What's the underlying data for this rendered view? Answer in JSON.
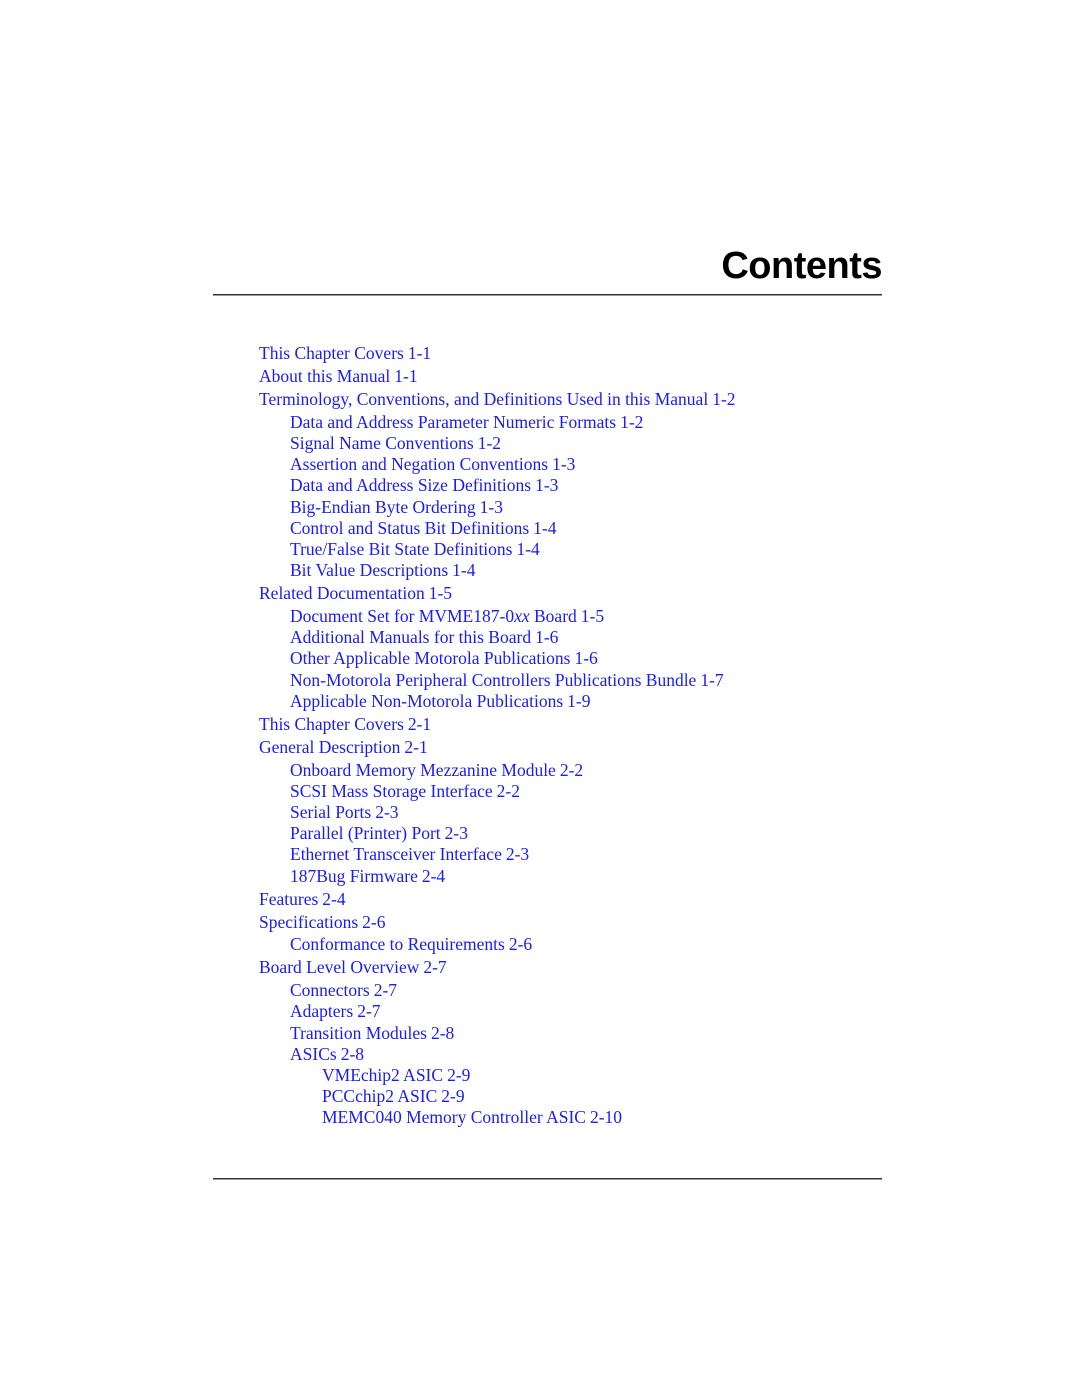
{
  "page_title": "Contents",
  "toc": [
    {
      "level": 1,
      "title": "This Chapter Covers",
      "page": "1-1"
    },
    {
      "level": 1,
      "title": "About this Manual",
      "page": "1-1"
    },
    {
      "level": 1,
      "title": "Terminology, Conventions, and Definitions Used in this Manual",
      "page": "1-2"
    },
    {
      "level": 2,
      "title": "Data and Address Parameter Numeric Formats",
      "page": "1-2"
    },
    {
      "level": 2,
      "title": "Signal Name Conventions",
      "page": "1-2"
    },
    {
      "level": 2,
      "title": "Assertion and Negation Conventions",
      "page": "1-3"
    },
    {
      "level": 2,
      "title": "Data and Address Size Definitions",
      "page": "1-3"
    },
    {
      "level": 2,
      "title": "Big-Endian Byte Ordering",
      "page": "1-3"
    },
    {
      "level": 2,
      "title": "Control and Status Bit Definitions",
      "page": "1-4"
    },
    {
      "level": 2,
      "title": "True/False Bit State Definitions",
      "page": "1-4"
    },
    {
      "level": 2,
      "title": "Bit Value Descriptions",
      "page": "1-4"
    },
    {
      "level": 1,
      "title": "Related Documentation",
      "page": "1-5"
    },
    {
      "level": 2,
      "title": "Document Set for MVME187-0",
      "title_italic": "xx",
      "title_suffix": " Board",
      "page": "1-5"
    },
    {
      "level": 2,
      "title": "Additional Manuals for this Board",
      "page": "1-6"
    },
    {
      "level": 2,
      "title": "Other Applicable Motorola Publications",
      "page": "1-6"
    },
    {
      "level": 2,
      "title": "Non-Motorola Peripheral Controllers Publications Bundle",
      "page": "1-7"
    },
    {
      "level": 2,
      "title": "Applicable Non-Motorola Publications",
      "page": "1-9"
    },
    {
      "level": 1,
      "title": "This Chapter Covers",
      "page": "2-1"
    },
    {
      "level": 1,
      "title": "General Description",
      "page": "2-1"
    },
    {
      "level": 2,
      "title": "Onboard Memory Mezzanine Module",
      "page": "2-2"
    },
    {
      "level": 2,
      "title": "SCSI Mass Storage Interface",
      "page": "2-2"
    },
    {
      "level": 2,
      "title": "Serial Ports",
      "page": "2-3"
    },
    {
      "level": 2,
      "title": "Parallel (Printer) Port",
      "page": "2-3"
    },
    {
      "level": 2,
      "title": "Ethernet Transceiver Interface",
      "page": "2-3"
    },
    {
      "level": 2,
      "title": "187Bug Firmware",
      "page": "2-4"
    },
    {
      "level": 1,
      "title": "Features",
      "page": "2-4"
    },
    {
      "level": 1,
      "title": "Specifications",
      "page": "2-6"
    },
    {
      "level": 2,
      "title": "Conformance to Requirements",
      "page": "2-6"
    },
    {
      "level": 1,
      "title": "Board Level Overview",
      "page": "2-7"
    },
    {
      "level": 2,
      "title": "Connectors",
      "page": "2-7"
    },
    {
      "level": 2,
      "title": "Adapters",
      "page": "2-7"
    },
    {
      "level": 2,
      "title": "Transition Modules",
      "page": "2-8"
    },
    {
      "level": 2,
      "title": "ASICs",
      "page": "2-8"
    },
    {
      "level": 3,
      "title": "VMEchip2 ASIC",
      "page": "2-9"
    },
    {
      "level": 3,
      "title": "PCCchip2 ASIC",
      "page": "2-9"
    },
    {
      "level": 3,
      "title": "MEMC040 Memory Controller ASIC",
      "page": "2-10"
    }
  ],
  "colors": {
    "link": "#1a1aff",
    "title": "#000000",
    "rule": "#333333"
  }
}
